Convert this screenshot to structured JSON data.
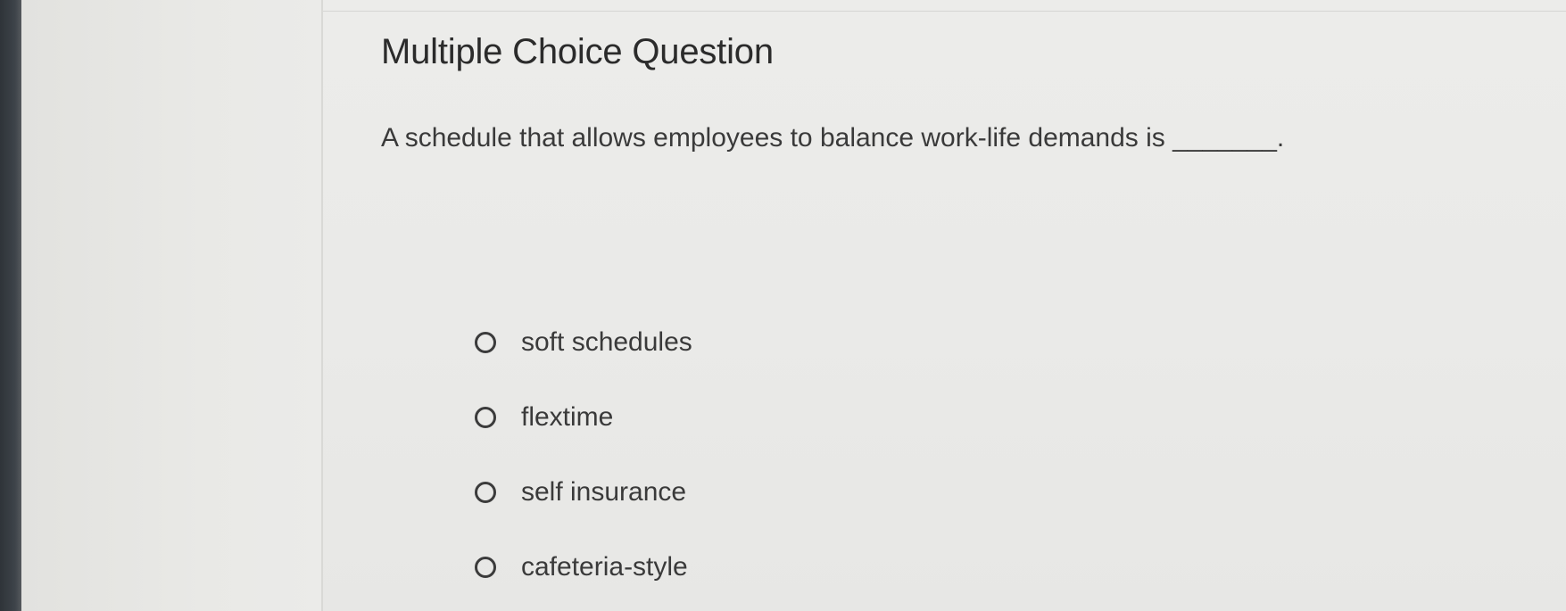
{
  "question": {
    "heading": "Multiple Choice Question",
    "prompt": "A schedule that allows employees to balance work-life demands is _______.",
    "options": [
      {
        "label": "soft schedules",
        "selected": false
      },
      {
        "label": "flextime",
        "selected": false
      },
      {
        "label": "self insurance",
        "selected": false
      },
      {
        "label": "cafeteria-style",
        "selected": false
      }
    ]
  }
}
